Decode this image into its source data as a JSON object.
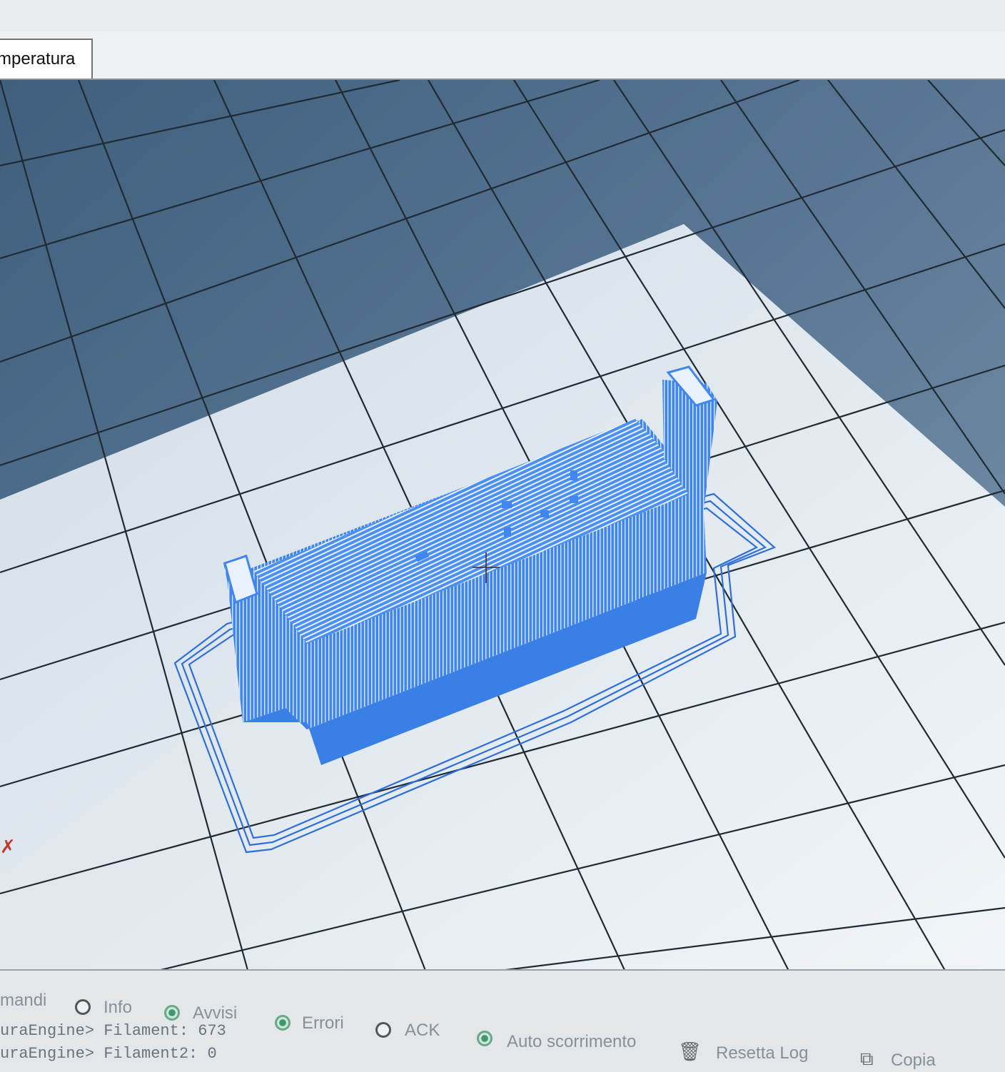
{
  "tabs": {
    "active_label": "mperatura"
  },
  "viewport": {
    "colors": {
      "background": "#4d6b86",
      "bed": "#e8eef3",
      "grid": "#1f2a33",
      "model": "#3f86ee",
      "skirt": "#2f6fd6"
    }
  },
  "log_panel": {
    "label": "mandi",
    "filters": [
      {
        "label": "Info",
        "checked": false
      },
      {
        "label": "Avvisi",
        "checked": true
      },
      {
        "label": "Errori",
        "checked": true
      },
      {
        "label": "ACK",
        "checked": false
      },
      {
        "label": "Auto scorrimento",
        "checked": true
      }
    ],
    "reset_label": "Resetta Log",
    "copy_label": "Copia",
    "lines": [
      "uraEngine> Filament: 673",
      "uraEngine> Filament2: 0"
    ]
  }
}
